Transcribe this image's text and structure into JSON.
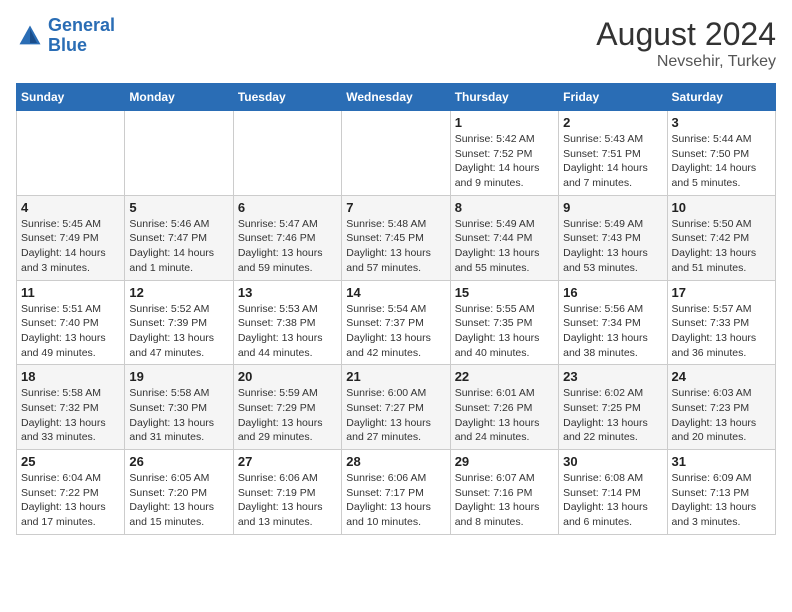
{
  "logo": {
    "line1": "General",
    "line2": "Blue"
  },
  "title": "August 2024",
  "location": "Nevsehir, Turkey",
  "days_header": [
    "Sunday",
    "Monday",
    "Tuesday",
    "Wednesday",
    "Thursday",
    "Friday",
    "Saturday"
  ],
  "weeks": [
    [
      {
        "day": "",
        "info": ""
      },
      {
        "day": "",
        "info": ""
      },
      {
        "day": "",
        "info": ""
      },
      {
        "day": "",
        "info": ""
      },
      {
        "day": "1",
        "info": "Sunrise: 5:42 AM\nSunset: 7:52 PM\nDaylight: 14 hours and 9 minutes."
      },
      {
        "day": "2",
        "info": "Sunrise: 5:43 AM\nSunset: 7:51 PM\nDaylight: 14 hours and 7 minutes."
      },
      {
        "day": "3",
        "info": "Sunrise: 5:44 AM\nSunset: 7:50 PM\nDaylight: 14 hours and 5 minutes."
      }
    ],
    [
      {
        "day": "4",
        "info": "Sunrise: 5:45 AM\nSunset: 7:49 PM\nDaylight: 14 hours and 3 minutes."
      },
      {
        "day": "5",
        "info": "Sunrise: 5:46 AM\nSunset: 7:47 PM\nDaylight: 14 hours and 1 minute."
      },
      {
        "day": "6",
        "info": "Sunrise: 5:47 AM\nSunset: 7:46 PM\nDaylight: 13 hours and 59 minutes."
      },
      {
        "day": "7",
        "info": "Sunrise: 5:48 AM\nSunset: 7:45 PM\nDaylight: 13 hours and 57 minutes."
      },
      {
        "day": "8",
        "info": "Sunrise: 5:49 AM\nSunset: 7:44 PM\nDaylight: 13 hours and 55 minutes."
      },
      {
        "day": "9",
        "info": "Sunrise: 5:49 AM\nSunset: 7:43 PM\nDaylight: 13 hours and 53 minutes."
      },
      {
        "day": "10",
        "info": "Sunrise: 5:50 AM\nSunset: 7:42 PM\nDaylight: 13 hours and 51 minutes."
      }
    ],
    [
      {
        "day": "11",
        "info": "Sunrise: 5:51 AM\nSunset: 7:40 PM\nDaylight: 13 hours and 49 minutes."
      },
      {
        "day": "12",
        "info": "Sunrise: 5:52 AM\nSunset: 7:39 PM\nDaylight: 13 hours and 47 minutes."
      },
      {
        "day": "13",
        "info": "Sunrise: 5:53 AM\nSunset: 7:38 PM\nDaylight: 13 hours and 44 minutes."
      },
      {
        "day": "14",
        "info": "Sunrise: 5:54 AM\nSunset: 7:37 PM\nDaylight: 13 hours and 42 minutes."
      },
      {
        "day": "15",
        "info": "Sunrise: 5:55 AM\nSunset: 7:35 PM\nDaylight: 13 hours and 40 minutes."
      },
      {
        "day": "16",
        "info": "Sunrise: 5:56 AM\nSunset: 7:34 PM\nDaylight: 13 hours and 38 minutes."
      },
      {
        "day": "17",
        "info": "Sunrise: 5:57 AM\nSunset: 7:33 PM\nDaylight: 13 hours and 36 minutes."
      }
    ],
    [
      {
        "day": "18",
        "info": "Sunrise: 5:58 AM\nSunset: 7:32 PM\nDaylight: 13 hours and 33 minutes."
      },
      {
        "day": "19",
        "info": "Sunrise: 5:58 AM\nSunset: 7:30 PM\nDaylight: 13 hours and 31 minutes."
      },
      {
        "day": "20",
        "info": "Sunrise: 5:59 AM\nSunset: 7:29 PM\nDaylight: 13 hours and 29 minutes."
      },
      {
        "day": "21",
        "info": "Sunrise: 6:00 AM\nSunset: 7:27 PM\nDaylight: 13 hours and 27 minutes."
      },
      {
        "day": "22",
        "info": "Sunrise: 6:01 AM\nSunset: 7:26 PM\nDaylight: 13 hours and 24 minutes."
      },
      {
        "day": "23",
        "info": "Sunrise: 6:02 AM\nSunset: 7:25 PM\nDaylight: 13 hours and 22 minutes."
      },
      {
        "day": "24",
        "info": "Sunrise: 6:03 AM\nSunset: 7:23 PM\nDaylight: 13 hours and 20 minutes."
      }
    ],
    [
      {
        "day": "25",
        "info": "Sunrise: 6:04 AM\nSunset: 7:22 PM\nDaylight: 13 hours and 17 minutes."
      },
      {
        "day": "26",
        "info": "Sunrise: 6:05 AM\nSunset: 7:20 PM\nDaylight: 13 hours and 15 minutes."
      },
      {
        "day": "27",
        "info": "Sunrise: 6:06 AM\nSunset: 7:19 PM\nDaylight: 13 hours and 13 minutes."
      },
      {
        "day": "28",
        "info": "Sunrise: 6:06 AM\nSunset: 7:17 PM\nDaylight: 13 hours and 10 minutes."
      },
      {
        "day": "29",
        "info": "Sunrise: 6:07 AM\nSunset: 7:16 PM\nDaylight: 13 hours and 8 minutes."
      },
      {
        "day": "30",
        "info": "Sunrise: 6:08 AM\nSunset: 7:14 PM\nDaylight: 13 hours and 6 minutes."
      },
      {
        "day": "31",
        "info": "Sunrise: 6:09 AM\nSunset: 7:13 PM\nDaylight: 13 hours and 3 minutes."
      }
    ]
  ]
}
